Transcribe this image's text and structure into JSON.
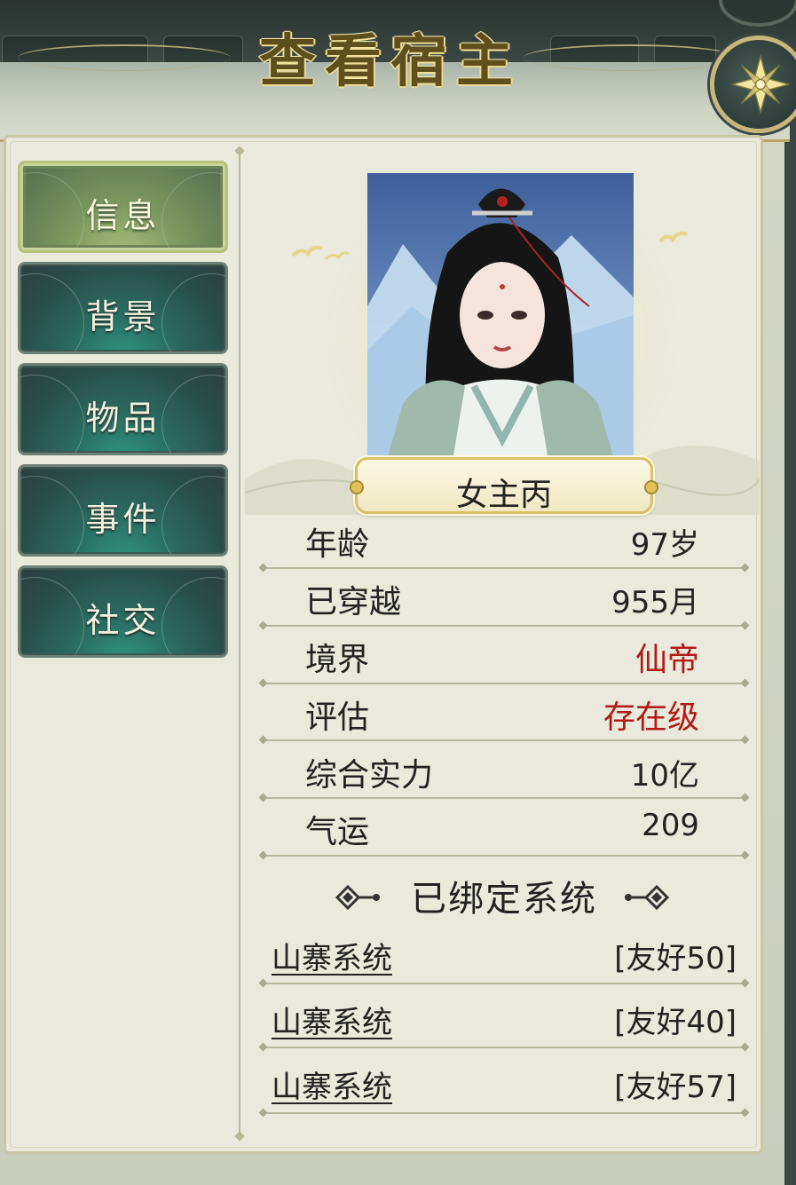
{
  "window": {
    "title": "查看宿主"
  },
  "sidebar": {
    "items": [
      {
        "label": "信息",
        "active": true
      },
      {
        "label": "背景",
        "active": false
      },
      {
        "label": "物品",
        "active": false
      },
      {
        "label": "事件",
        "active": false
      },
      {
        "label": "社交",
        "active": false
      }
    ]
  },
  "character": {
    "name": "女主丙",
    "portrait": "female-cultivator-portrait"
  },
  "stats": [
    {
      "label": "年龄",
      "value": "97岁",
      "highlight": false
    },
    {
      "label": "已穿越",
      "value": "955月",
      "highlight": false
    },
    {
      "label": "境界",
      "value": "仙帝",
      "highlight": true
    },
    {
      "label": "评估",
      "value": "存在级",
      "highlight": true
    },
    {
      "label": "综合实力",
      "value": "10亿",
      "highlight": false
    },
    {
      "label": "气运",
      "value": "209",
      "highlight": false
    }
  ],
  "systems_section": {
    "title": "已绑定系统",
    "items": [
      {
        "name": "山寨系统",
        "relation": "[友好50]"
      },
      {
        "name": "山寨系统",
        "relation": "[友好40]"
      },
      {
        "name": "山寨系统",
        "relation": "[友好57]"
      }
    ]
  },
  "colors": {
    "highlight_value": "#b21a17",
    "title_gold": "#5e4f1d",
    "nav_active": "#7c9960",
    "nav_inactive": "#2a6f63"
  },
  "icons": {
    "close": "shuriken-close-icon"
  }
}
